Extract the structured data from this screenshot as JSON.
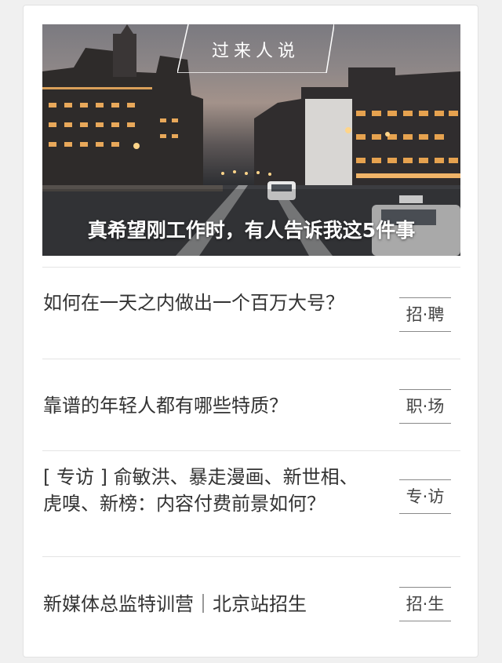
{
  "hero": {
    "tag": "过来人说",
    "caption": "真希望刚工作时，有人告诉我这5件事"
  },
  "articles": [
    {
      "title": "如何在一天之内做出一个百万大号？",
      "tag": "招·聘"
    },
    {
      "title": "靠谱的年轻人都有哪些特质？",
      "tag": "职·场"
    },
    {
      "title": "[ 专访 ] 俞敏洪、暴走漫画、新世相、虎嗅、新榜：内容付费前景如何？",
      "tag": "专·访"
    },
    {
      "title": "新媒体总监特训营｜北京站招生",
      "tag": "招·生"
    }
  ]
}
